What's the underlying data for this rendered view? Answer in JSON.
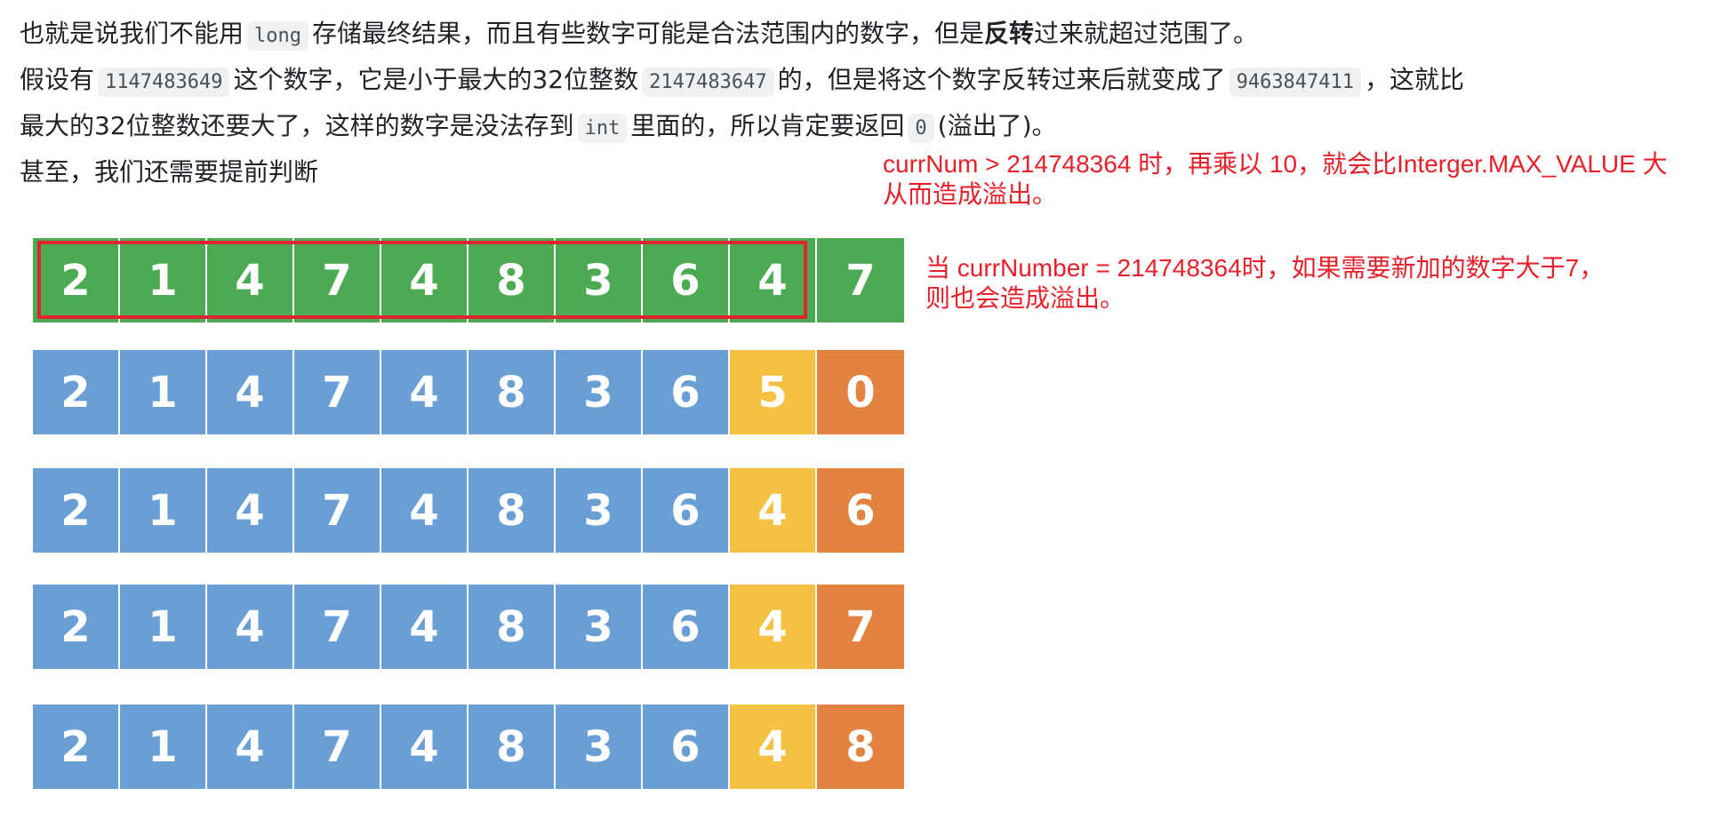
{
  "paragraph": {
    "line1": {
      "a": "也就是说我们不能用",
      "code1": "long",
      "b": "存储最终结果，而且有些数字可能是合法范围内的数字，但是",
      "bold": "反转",
      "c": "过来就超过范围了。"
    },
    "line2": {
      "a": "假设有",
      "code1": "1147483649",
      "b": "这个数字，它是小于最大的32位整数",
      "code2": "2147483647",
      "c": "的，但是将这个数字反转过来后就变成了",
      "code3": "9463847411",
      "d": "，这就比"
    },
    "line3": {
      "a": "最大的32位整数还要大了，这样的数字是没法存到",
      "code1": "int",
      "b": "里面的，所以肯定要返回",
      "code2": "0",
      "c": "(溢出了)。"
    },
    "line4": "甚至，我们还需要提前判断"
  },
  "note1": {
    "line1": "currNum > 214748364 时，再乘以 10，就会比Interger.MAX_VALUE 大",
    "line2": "从而造成溢出。"
  },
  "note2": {
    "line1": "当 currNumber = 214748364时，如果需要新加的数字大于7，",
    "line2": "则也会造成溢出。"
  },
  "colors": {
    "green": "#4caa53",
    "blue": "#6a9fd6",
    "yellow": "#f6c142",
    "orange": "#e2843f",
    "annotation_red": "#e8202a"
  },
  "digit_rows": [
    {
      "digits": [
        "2",
        "1",
        "4",
        "7",
        "4",
        "8",
        "3",
        "6",
        "4",
        "7"
      ],
      "colors": [
        "green",
        "green",
        "green",
        "green",
        "green",
        "green",
        "green",
        "green",
        "green",
        "green"
      ]
    },
    {
      "digits": [
        "2",
        "1",
        "4",
        "7",
        "4",
        "8",
        "3",
        "6",
        "5",
        "0"
      ],
      "colors": [
        "blue",
        "blue",
        "blue",
        "blue",
        "blue",
        "blue",
        "blue",
        "blue",
        "yellow",
        "orange"
      ]
    },
    {
      "digits": [
        "2",
        "1",
        "4",
        "7",
        "4",
        "8",
        "3",
        "6",
        "4",
        "6"
      ],
      "colors": [
        "blue",
        "blue",
        "blue",
        "blue",
        "blue",
        "blue",
        "blue",
        "blue",
        "yellow",
        "orange"
      ]
    },
    {
      "digits": [
        "2",
        "1",
        "4",
        "7",
        "4",
        "8",
        "3",
        "6",
        "4",
        "7"
      ],
      "colors": [
        "blue",
        "blue",
        "blue",
        "blue",
        "blue",
        "blue",
        "blue",
        "blue",
        "yellow",
        "orange"
      ]
    },
    {
      "digits": [
        "2",
        "1",
        "4",
        "7",
        "4",
        "8",
        "3",
        "6",
        "4",
        "8"
      ],
      "colors": [
        "blue",
        "blue",
        "blue",
        "blue",
        "blue",
        "blue",
        "blue",
        "blue",
        "yellow",
        "orange"
      ]
    }
  ]
}
